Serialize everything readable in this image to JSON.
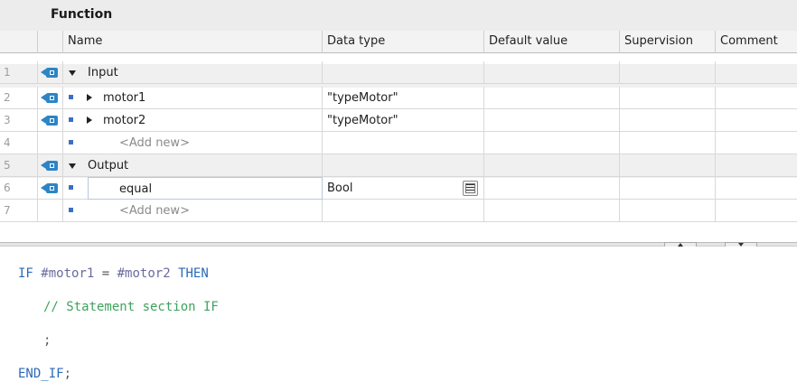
{
  "interface": {
    "title": "Function",
    "columns": [
      "Name",
      "Data type",
      "Default value",
      "Supervision",
      "Comment"
    ],
    "rows": [
      {
        "num": "1",
        "name": "Input",
        "type": ""
      },
      {
        "num": "2",
        "name": "motor1",
        "type": "\"typeMotor\""
      },
      {
        "num": "3",
        "name": "motor2",
        "type": "\"typeMotor\""
      },
      {
        "num": "4",
        "name": "<Add new>",
        "type": ""
      },
      {
        "num": "5",
        "name": "Output",
        "type": ""
      },
      {
        "num": "6",
        "name": "equal",
        "type": "Bool"
      },
      {
        "num": "7",
        "name": "<Add new>",
        "type": ""
      }
    ]
  },
  "code": {
    "l1_kw1": "IF",
    "l1_var1": "#motor1",
    "l1_op": "=",
    "l1_var2": "#motor2",
    "l1_kw2": "THEN",
    "l2_comment": "// Statement section IF",
    "l3_semicolon": ";",
    "l4_kw": "END_IF",
    "l4_semicolon": ";"
  },
  "icons": {
    "inout": "parameter-interface-icon",
    "expand": "triangle-down-icon",
    "collapse": "triangle-right-icon",
    "member": "member-square-icon",
    "list": "list-picker-icon"
  },
  "colors": {
    "keyword": "#2a6ab8",
    "comment": "#3da35d",
    "interface_icon": "#2b85c6",
    "member_square": "#3b6fc4"
  }
}
